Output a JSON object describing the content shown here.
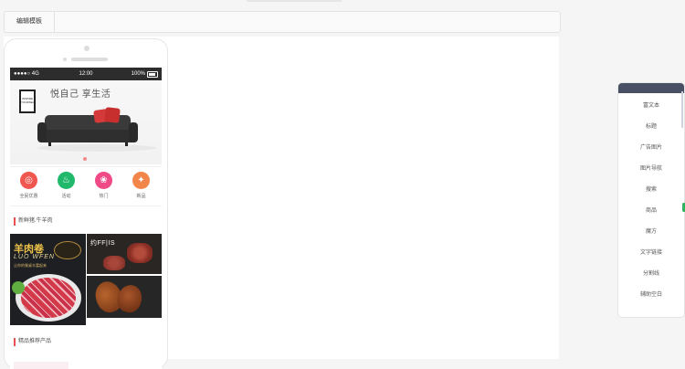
{
  "toolbar": {
    "active_tab": "编辑模板"
  },
  "phone": {
    "status": {
      "signal": "●●●●○ 4G",
      "time": "12:00",
      "battery": "100%"
    },
    "banner": {
      "title": "悦自己 享生活",
      "frame_text": "INSPIRE\nYOURSELF"
    },
    "nav": [
      {
        "label": "全民优惠",
        "color": "#f0584f",
        "icon": "◎"
      },
      {
        "label": "活动",
        "color": "#20b86a",
        "icon": "♨"
      },
      {
        "label": "热门",
        "color": "#ef4a86",
        "icon": "❀"
      },
      {
        "label": "新品",
        "color": "#f2864a",
        "icon": "✦"
      }
    ],
    "section1": "新鲜猪.牛羊肉",
    "products": {
      "big_title": "羊肉卷",
      "big_sub": "LUO WFEN",
      "big_line": "让你的餐桌丰富起来",
      "top_right_title": "约FF|IS"
    },
    "section2": "精品推荐产品"
  },
  "right_panel": {
    "items": [
      "富文本",
      "标题",
      "广告图片",
      "图片导航",
      "搜索",
      "商品",
      "魔方",
      "文字链接",
      "分割线",
      "辅助空白"
    ]
  },
  "colors": {
    "panel_header": "#4a5064",
    "accent_red": "#e85050"
  }
}
